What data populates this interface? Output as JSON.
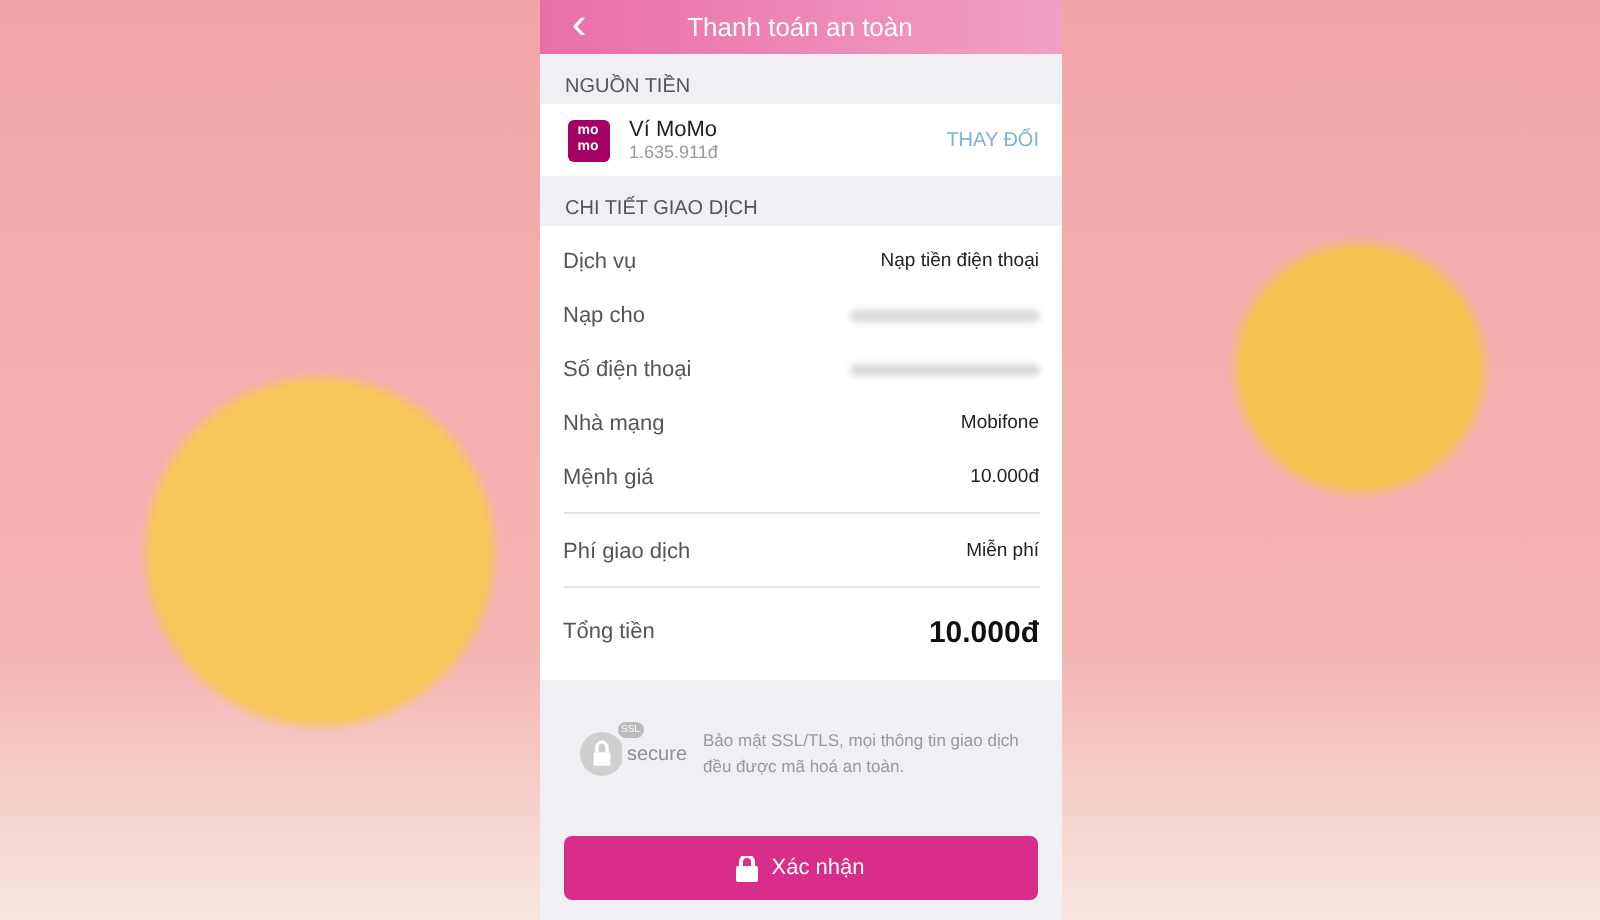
{
  "header": {
    "back": "‹",
    "title": "Thanh toán an toàn"
  },
  "source": {
    "label": "NGUỒN TIỀN",
    "wallet_name": "Ví MoMo",
    "balance": "1.635.911đ",
    "logo_top": "mo",
    "logo_bottom": "mo",
    "change": "THAY ĐỔI"
  },
  "details": {
    "label": "CHI TIẾT GIAO DỊCH",
    "rows": [
      {
        "label": "Dịch vụ",
        "value": "Nạp tiền điện thoại",
        "redacted": false,
        "divider_before": false
      },
      {
        "label": "Nạp cho",
        "redacted": true,
        "divider_before": false
      },
      {
        "label": "Số điện thoại",
        "redacted": true,
        "divider_before": false
      },
      {
        "label": "Nhà mạng",
        "value": "Mobifone",
        "redacted": false,
        "divider_before": false
      },
      {
        "label": "Mệnh giá",
        "value": "10.000đ",
        "redacted": false,
        "divider_before": false
      },
      {
        "label": "Phí giao dịch",
        "value": "Miễn phí",
        "redacted": false,
        "divider_before": true
      }
    ],
    "total_label": "Tổng tiền",
    "total_value": "10.000đ"
  },
  "security": {
    "badge": "SSL",
    "logo_text": "secure",
    "note": "Bảo mật SSL/TLS, mọi thông tin giao dịch đều được mã hoá an toàn."
  },
  "confirm": "Xác nhận"
}
